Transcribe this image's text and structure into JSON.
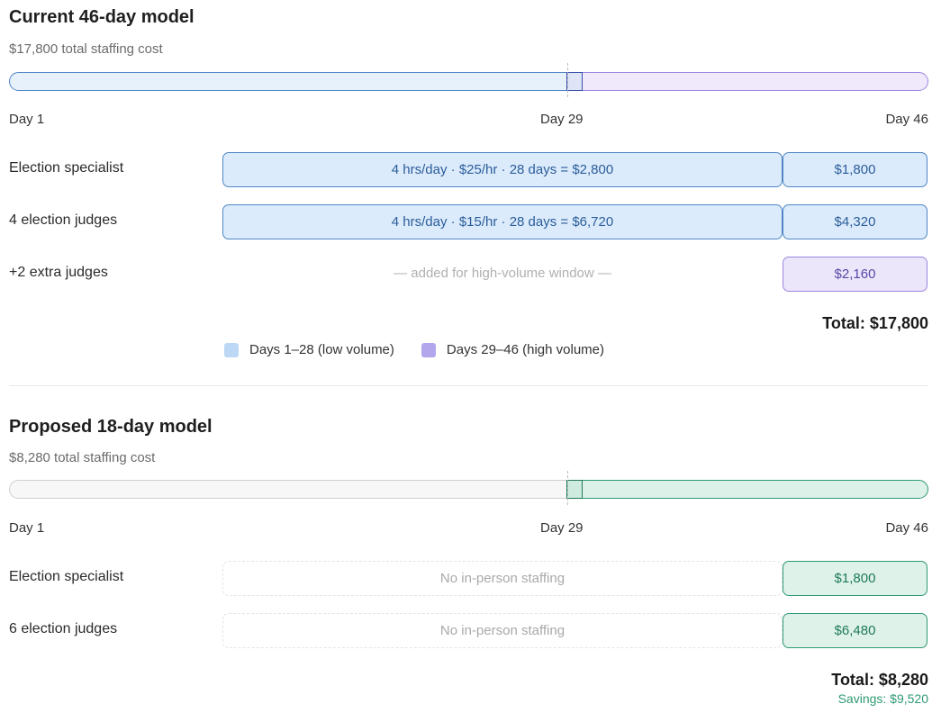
{
  "current": {
    "title": "Current 46-day model",
    "subtitle": "$17,800 total staffing cost",
    "timeline": {
      "start": "Day 1",
      "mid": "Day 29",
      "end": "Day 46"
    },
    "rows": [
      {
        "label": "Election specialist",
        "low_text": "4 hrs/day · $25/hr · 28 days = $2,800",
        "high_text": "$1,800"
      },
      {
        "label": "4 election judges",
        "low_text": "4 hrs/day · $15/hr · 28 days = $6,720",
        "high_text": "$4,320"
      },
      {
        "label": "+2 extra judges",
        "low_text": "— added for high-volume window —",
        "high_text": "$2,160"
      }
    ],
    "total": "Total: $17,800",
    "legend": [
      {
        "label": "Days 1–28 (low volume)",
        "color": "#bcd8f5"
      },
      {
        "label": "Days 29–46 (high volume)",
        "color": "#b3a6ec"
      }
    ]
  },
  "proposed": {
    "title": "Proposed 18-day model",
    "subtitle": "$8,280 total staffing cost",
    "timeline": {
      "start": "Day 1",
      "mid": "Day 29",
      "end": "Day 46"
    },
    "rows": [
      {
        "label": "Election specialist",
        "low_text": "No in-person staffing",
        "high_text": "$1,800"
      },
      {
        "label": "6 election judges",
        "low_text": "No in-person staffing",
        "high_text": "$6,480"
      }
    ],
    "total": "Total: $8,280",
    "savings": "Savings: $9,520"
  },
  "colors": {
    "blue_fill": "#dcebfb",
    "blue_border": "#4f86c6",
    "purple_fill": "#ece6fa",
    "purple_border": "#9b86e0",
    "green_fill": "#def2ea",
    "green_border": "#2f9a73",
    "gray_fill": "#f7f7f7"
  }
}
